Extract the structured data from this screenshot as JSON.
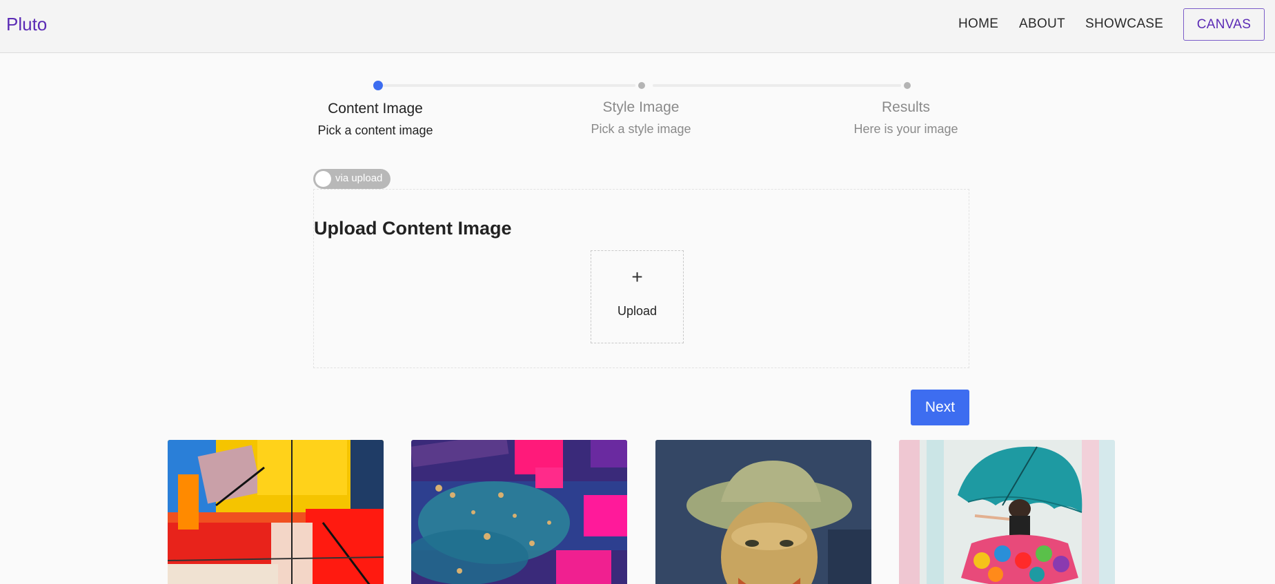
{
  "nav": {
    "brand": "Pluto",
    "links": [
      "HOME",
      "ABOUT",
      "SHOWCASE"
    ],
    "canvas_label": "CANVAS",
    "brand_color": "#5b2bb5"
  },
  "steps": [
    {
      "title": "Content Image",
      "subtitle": "Pick a content image",
      "state": "active"
    },
    {
      "title": "Style Image",
      "subtitle": "Pick a style image",
      "state": "waiting"
    },
    {
      "title": "Results",
      "subtitle": "Here is your image",
      "state": "waiting"
    }
  ],
  "toggle": {
    "label": "via upload",
    "checked": false
  },
  "upload": {
    "title": "Upload Content Image",
    "button_label": "Upload",
    "plus": "+"
  },
  "next_label": "Next",
  "accent_color": "#3d6df0",
  "gallery": [
    {
      "name": "abstract-red-yellow-painting"
    },
    {
      "name": "purple-pink-splatter-painting"
    },
    {
      "name": "van-gogh-self-portrait"
    },
    {
      "name": "girl-with-teal-umbrella-painting"
    }
  ]
}
